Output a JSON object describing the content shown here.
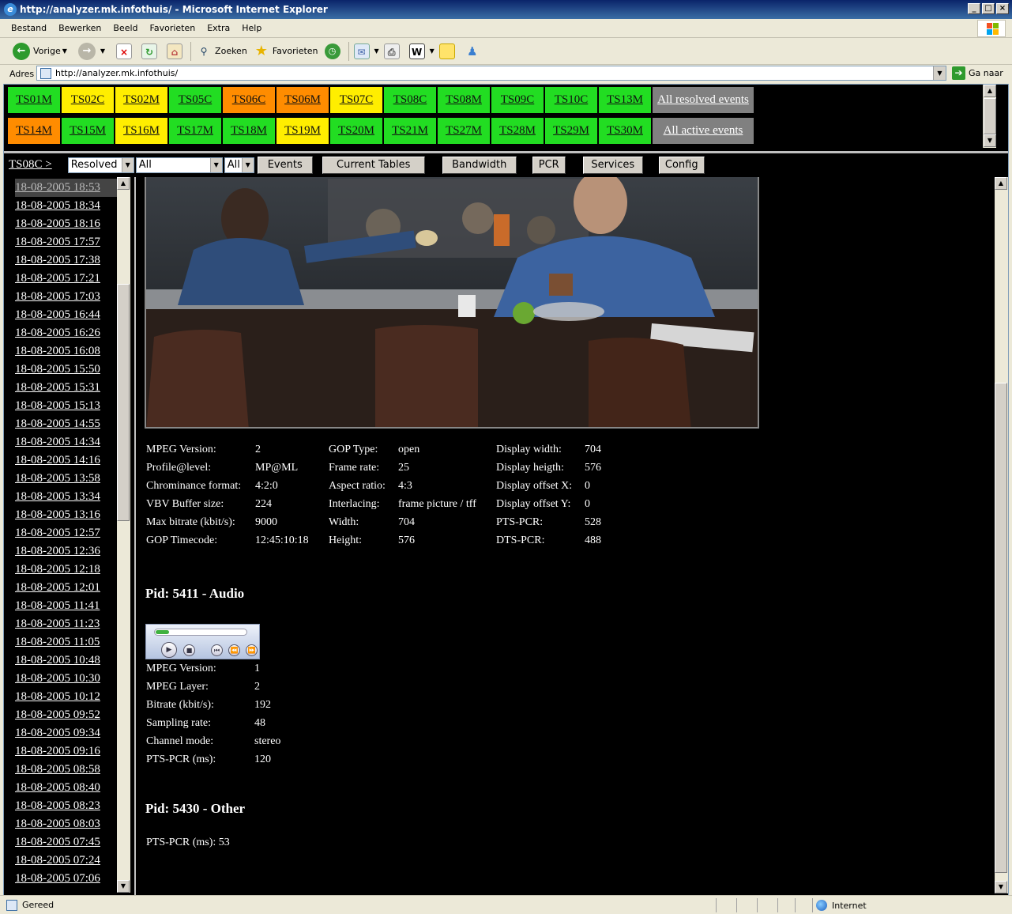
{
  "window": {
    "title": "http://analyzer.mk.infothuis/ - Microsoft Internet Explorer"
  },
  "menu": [
    "Bestand",
    "Bewerken",
    "Beeld",
    "Favorieten",
    "Extra",
    "Help"
  ],
  "toolbar": {
    "back_label": "Vorige",
    "search_label": "Zoeken",
    "favorites_label": "Favorieten"
  },
  "address": {
    "label": "Adres",
    "url": "http://analyzer.mk.infothuis/",
    "go_label": "Ga naar"
  },
  "ts_rows": [
    [
      {
        "label": "TS01M",
        "status": "green"
      },
      {
        "label": "TS02C",
        "status": "yellow"
      },
      {
        "label": "TS02M",
        "status": "yellow"
      },
      {
        "label": "TS05C",
        "status": "green"
      },
      {
        "label": "TS06C",
        "status": "orange"
      },
      {
        "label": "TS06M",
        "status": "orange"
      },
      {
        "label": "TS07C",
        "status": "yellow"
      },
      {
        "label": "TS08C",
        "status": "green"
      },
      {
        "label": "TS08M",
        "status": "green"
      },
      {
        "label": "TS09C",
        "status": "green"
      },
      {
        "label": "TS10C",
        "status": "green"
      },
      {
        "label": "TS13M",
        "status": "green"
      },
      {
        "label": "All resolved events",
        "status": "all"
      }
    ],
    [
      {
        "label": "TS14M",
        "status": "orange"
      },
      {
        "label": "TS15M",
        "status": "green"
      },
      {
        "label": "TS16M",
        "status": "yellow"
      },
      {
        "label": "TS17M",
        "status": "green"
      },
      {
        "label": "TS18M",
        "status": "green"
      },
      {
        "label": "TS19M",
        "status": "yellow"
      },
      {
        "label": "TS20M",
        "status": "green"
      },
      {
        "label": "TS21M",
        "status": "green"
      },
      {
        "label": "TS27M",
        "status": "green"
      },
      {
        "label": "TS28M",
        "status": "green"
      },
      {
        "label": "TS29M",
        "status": "green"
      },
      {
        "label": "TS30M",
        "status": "green"
      },
      {
        "label": "All active events",
        "status": "all"
      }
    ]
  ],
  "status_colors": {
    "green": "#22dd22",
    "yellow": "#ffee00",
    "orange": "#ff8c00",
    "all": "#808080"
  },
  "controls": {
    "ts_link": "TS08C >",
    "filter_select": "Resolved",
    "type_select": "All",
    "level_select": "All",
    "buttons": [
      "Events",
      "Current Tables",
      "Bandwidth",
      "PCR",
      "Services",
      "Config"
    ]
  },
  "dates": [
    "18-08-2005 18:53",
    "18-08-2005 18:34",
    "18-08-2005 18:16",
    "18-08-2005 17:57",
    "18-08-2005 17:38",
    "18-08-2005 17:21",
    "18-08-2005 17:03",
    "18-08-2005 16:44",
    "18-08-2005 16:26",
    "18-08-2005 16:08",
    "18-08-2005 15:50",
    "18-08-2005 15:31",
    "18-08-2005 15:13",
    "18-08-2005 14:55",
    "18-08-2005 14:34",
    "18-08-2005 14:16",
    "18-08-2005 13:58",
    "18-08-2005 13:34",
    "18-08-2005 13:16",
    "18-08-2005 12:57",
    "18-08-2005 12:36",
    "18-08-2005 12:18",
    "18-08-2005 12:01",
    "18-08-2005 11:41",
    "18-08-2005 11:23",
    "18-08-2005 11:05",
    "18-08-2005 10:48",
    "18-08-2005 10:30",
    "18-08-2005 10:12",
    "18-08-2005 09:52",
    "18-08-2005 09:34",
    "18-08-2005 09:16",
    "18-08-2005 08:58",
    "18-08-2005 08:40",
    "18-08-2005 08:23",
    "18-08-2005 08:03",
    "18-08-2005 07:45",
    "18-08-2005 07:24",
    "18-08-2005 07:06"
  ],
  "video": {
    "col1": [
      [
        "MPEG Version:",
        "2"
      ],
      [
        "Profile@level:",
        "MP@ML"
      ],
      [
        "Chrominance format:",
        "4:2:0"
      ],
      [
        "VBV Buffer size:",
        "224"
      ],
      [
        "Max bitrate (kbit/s):",
        "9000"
      ],
      [
        "GOP Timecode:",
        "12:45:10:18"
      ]
    ],
    "col2": [
      [
        "GOP Type:",
        "open"
      ],
      [
        "Frame rate:",
        "25"
      ],
      [
        "Aspect ratio:",
        "4:3"
      ],
      [
        "Interlacing:",
        "frame picture / tff"
      ],
      [
        "Width:",
        "704"
      ],
      [
        "Height:",
        "576"
      ]
    ],
    "col3": [
      [
        "Display width:",
        "704"
      ],
      [
        "Display heigth:",
        "576"
      ],
      [
        "Display offset X:",
        "0"
      ],
      [
        "Display offset Y:",
        "0"
      ],
      [
        "PTS-PCR:",
        "528"
      ],
      [
        "DTS-PCR:",
        "488"
      ]
    ]
  },
  "audio": {
    "title": "Pid: 5411 - Audio",
    "player_progress": 0.15,
    "rows": [
      [
        "MPEG Version:",
        "1"
      ],
      [
        "MPEG Layer:",
        "2"
      ],
      [
        "Bitrate (kbit/s):",
        "192"
      ],
      [
        "Sampling rate:",
        "48"
      ],
      [
        "Channel mode:",
        "stereo"
      ],
      [
        "PTS-PCR (ms):",
        "120"
      ]
    ]
  },
  "other": {
    "title": "Pid: 5430 - Other",
    "line": "PTS-PCR (ms): 53"
  },
  "status": {
    "text": "Gereed",
    "zone": "Internet"
  }
}
